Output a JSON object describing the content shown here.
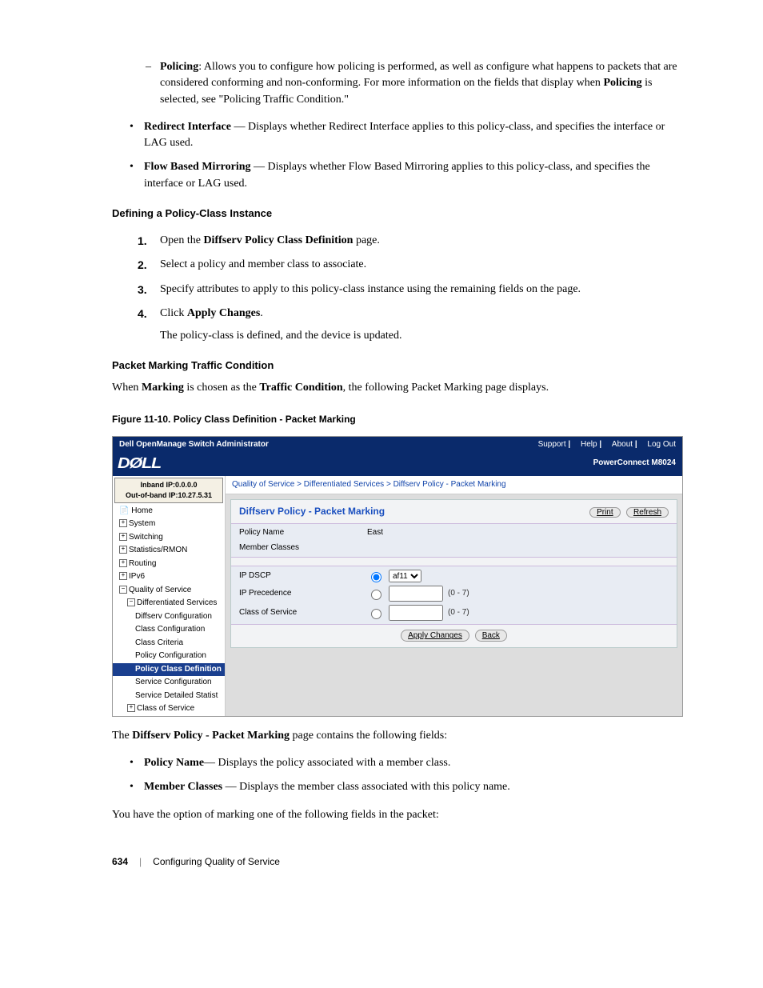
{
  "policing_item": {
    "label": "Policing",
    "text": ": Allows you to configure how policing is performed, as well as configure what happens to packets that are considered conforming and non-conforming. For more information on the fields that display when ",
    "bold2": "Policing",
    "text2": " is selected, see \"Policing Traffic Condition.\""
  },
  "redirect_item": {
    "label": "Redirect Interface",
    "text": " — Displays whether Redirect Interface applies to this policy-class, and specifies the interface or LAG used."
  },
  "flow_item": {
    "label": "Flow Based Mirroring",
    "text": " — Displays whether Flow Based Mirroring applies to this policy-class, and specifies the interface or LAG used."
  },
  "heading1": "Defining a Policy-Class Instance",
  "steps": {
    "s1a": "Open the ",
    "s1b": "Diffserv Policy Class Definition",
    "s1c": " page.",
    "s2": "Select a policy and member class to associate.",
    "s3": "Specify attributes to apply to this policy-class instance using the remaining fields on the page.",
    "s4a": "Click ",
    "s4b": "Apply Changes",
    "s4c": ".",
    "s4result": "The policy-class is defined, and the device is updated."
  },
  "heading2": "Packet Marking Traffic Condition",
  "marking_sentence": {
    "p1": "When ",
    "b1": "Marking",
    "p2": " is chosen as the ",
    "b2": "Traffic Condition",
    "p3": ", the following Packet Marking page displays."
  },
  "figure_caption": "Figure 11-10.    Policy Class Definition - Packet Marking",
  "fig": {
    "titlebar": "Dell OpenManage Switch Administrator",
    "links": {
      "support": "Support",
      "help": "Help",
      "about": "About",
      "logout": "Log Out"
    },
    "logo": "DØLL",
    "product": "PowerConnect M8024",
    "ip1": "Inband IP:0.0.0.0",
    "ip2": "Out-of-band IP:10.27.5.31",
    "nav": {
      "home": "Home",
      "system": "System",
      "switching": "Switching",
      "stats": "Statistics/RMON",
      "routing": "Routing",
      "ipv6": "IPv6",
      "qos": "Quality of Service",
      "diff": "Differentiated Services",
      "dconf": "Diffserv Configuration",
      "cconf": "Class Configuration",
      "ccrit": "Class Criteria",
      "pconf": "Policy Configuration",
      "pcdef": "Policy Class Definition",
      "sconf": "Service Configuration",
      "sdstat": "Service Detailed Statist",
      "cos": "Class of Service"
    },
    "breadcrumb": "Quality of Service > Differentiated Services > Diffserv Policy - Packet Marking",
    "panel_title": "Diffserv Policy - Packet Marking",
    "print": "Print",
    "refresh": "Refresh",
    "row_policy_label": "Policy Name",
    "row_policy_value": "East",
    "row_member_label": "Member Classes",
    "row_dscp": "IP DSCP",
    "row_dscp_opt": "af11",
    "row_prec": "IP Precedence",
    "row_prec_hint": "(0 - 7)",
    "row_cos": "Class of Service",
    "row_cos_hint": "(0 - 7)",
    "apply": "Apply Changes",
    "back": "Back"
  },
  "after_fig": {
    "p1": "The ",
    "b1": "Diffserv Policy - Packet Marking",
    "p2": " page contains the following fields:"
  },
  "field_policy": {
    "label": "Policy Name",
    "text": "— Displays the policy associated with a member class."
  },
  "field_member": {
    "label": "Member Classes",
    "text": " — Displays the member class associated with this policy name."
  },
  "closing": "You have the option of marking one of the following fields in the packet:",
  "footer": {
    "page": "634",
    "section": "Configuring Quality of Service"
  }
}
